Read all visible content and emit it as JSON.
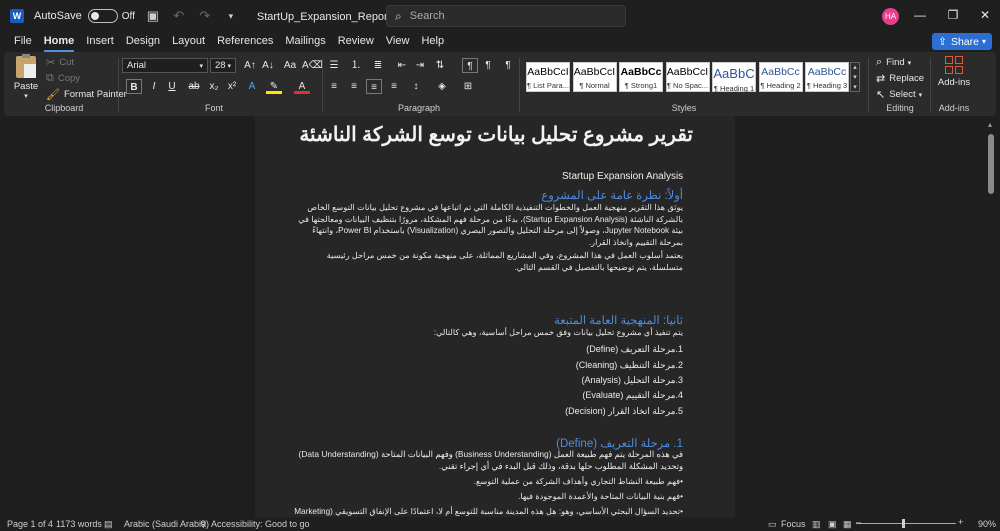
{
  "titlebar": {
    "app_icon": "W",
    "autosave_label": "AutoSave",
    "autosave_state": "Off",
    "doc_title": "StartUp_Expansion_Report • Saved to this PC ⌄",
    "search_placeholder": "Search",
    "avatar_initials": "HA"
  },
  "menu": {
    "tabs": [
      "File",
      "Home",
      "Insert",
      "Design",
      "Layout",
      "References",
      "Mailings",
      "Review",
      "View",
      "Help"
    ],
    "active_tab": "Home",
    "share_label": "Share"
  },
  "ribbon": {
    "clipboard": {
      "paste": "Paste",
      "cut": "Cut",
      "copy": "Copy",
      "format_painter": "Format Painter",
      "label": "Clipboard"
    },
    "font": {
      "family": "Arial",
      "size": "28",
      "label": "Font"
    },
    "paragraph": {
      "label": "Paragraph"
    },
    "styles": {
      "label": "Styles",
      "tiles": [
        {
          "sample": "AaBbCcI",
          "name": "¶ List Para..."
        },
        {
          "sample": "AaBbCcI",
          "name": "¶ Normal"
        },
        {
          "sample": "AaBbCc",
          "name": "¶ Strong1"
        },
        {
          "sample": "AaBbCcI",
          "name": "¶ No Spac..."
        },
        {
          "sample": "AaBbC",
          "name": "¶ Heading 1"
        },
        {
          "sample": "AaBbCc",
          "name": "¶ Heading 2"
        },
        {
          "sample": "AaBbCc",
          "name": "¶ Heading 3"
        }
      ]
    },
    "editing": {
      "find": "Find",
      "replace": "Replace",
      "select": "Select",
      "label": "Editing"
    },
    "addins": {
      "button": "Add-ins",
      "label": "Add-ins"
    }
  },
  "document": {
    "title": "تقرير مشروع تحليل بيانات توسع الشركة الناشئة",
    "subtitle": "Startup Expansion Analysis",
    "h1": "أولاً: نظرة عامة على المشروع",
    "p1": "يوثق هذا التقرير منهجية العمل والخطوات التنفيذية الكاملة التي تم اتباعها في مشروع تحليل بيانات التوسع الخاص بالشركة الناشئة (Startup Expansion Analysis)، بدءًا من مرحلة فهم المشكلة، مرورًا بتنظيف البيانات ومعالجتها في بيئة Jupyter Notebook، وصولاً إلى مرحلة التحليل والتصور البصري (Visualization) باستخدام Power BI، وانتهاءً بمرحلة التقييم واتخاذ القرار.",
    "p2": "يعتمد أسلوب العمل في هذا المشروع، وفي المشاريع المماثلة، على منهجية مكونة من خمس مراحل رئيسية متسلسلة، يتم توضيحها بالتفصيل في القسم التالي.",
    "h2": "ثانيا: المنهجية العامة المتبعة",
    "p3": "يتم تنفيذ أي مشروع تحليل بيانات وفق خمس مراحل أساسية، وهي كالتالي:",
    "steps": [
      "1.مرحلة التعريف (Define)",
      "2.مرحلة التنظيف (Cleaning)",
      "3.مرحلة التحليل (Analysis)",
      "4.مرحلة التقييم (Evaluate)",
      "5.مرحلة اتخاذ القرار (Decision)"
    ],
    "h3": "1. مرحلة التعريف (Define)",
    "p4": "في هذه المرحلة يتم فهم طبيعة العمل (Business Understanding) وفهم البيانات المتاحة (Data Understanding) وتحديد المشكلة المطلوب حلها بدقة، وذلك قبل البدء في أي إجراء تقني.",
    "bullets": [
      "•فهم طبيعة النشاط التجاري وأهداف الشركة من عملية التوسع.",
      "•فهم بنية البيانات المتاحة والأعمدة الموجودة فيها.",
      "•تحديد السؤال البحثي الأساسي، وهو: هل هذه المدينة مناسبة للتوسع أم لا، اعتمادًا على الإنفاق التسويقي (Marketing"
    ]
  },
  "status": {
    "page": "Page 1 of 4",
    "words": "1173 words",
    "language": "Arabic (Saudi Arabia)",
    "accessibility": "Accessibility: Good to go",
    "focus": "Focus",
    "zoom": "90%"
  }
}
